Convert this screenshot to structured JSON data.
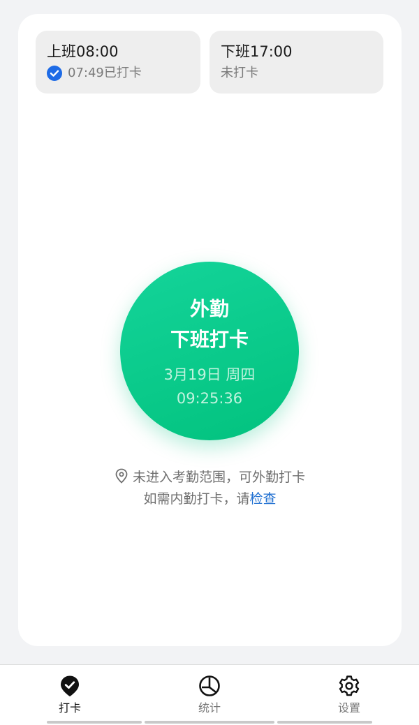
{
  "shifts": {
    "on": {
      "title": "上班08:00",
      "status": "07:49已打卡"
    },
    "off": {
      "title": "下班17:00",
      "status": "未打卡"
    }
  },
  "punch": {
    "line1": "外勤",
    "line2": "下班打卡",
    "date": "3月19日 周四",
    "time": "09:25:36"
  },
  "hint": {
    "location": "未进入考勤范围，可外勤打卡",
    "prefix": "如需内勤打卡，请",
    "link": "检查"
  },
  "tabs": [
    {
      "label": "打卡",
      "icon": "map-pin-check-icon"
    },
    {
      "label": "统计",
      "icon": "pie-chart-icon"
    },
    {
      "label": "设置",
      "icon": "gear-icon"
    }
  ],
  "colors": {
    "accent": "#02c27e",
    "link": "#1f6fd1",
    "check": "#1e6be6"
  }
}
